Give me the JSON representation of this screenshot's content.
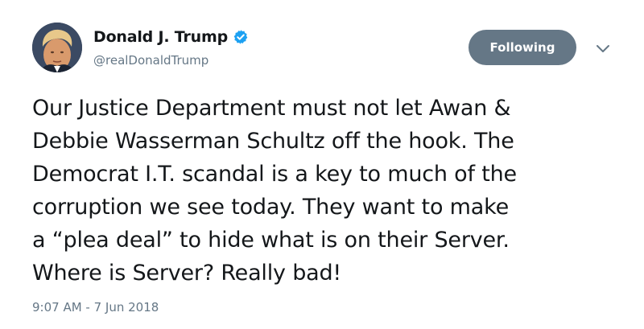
{
  "author": {
    "display_name": "Donald J. Trump",
    "handle": "@realDonaldTrump",
    "verified": true,
    "verified_color": "#1da1f2"
  },
  "follow_button": {
    "label": "Following",
    "background": "#657786"
  },
  "menu": {
    "icon": "chevron-down-icon"
  },
  "tweet": {
    "text": "Our Justice Department must not let Awan &\nDebbie Wasserman Schultz off the hook. The\nDemocrat I.T. scandal is a key to much of the\ncorruption we see today. They want to make\na “plea deal” to hide what is on their Server.\nWhere is Server? Really bad!",
    "timestamp": "9:07 AM - 7 Jun 2018"
  }
}
